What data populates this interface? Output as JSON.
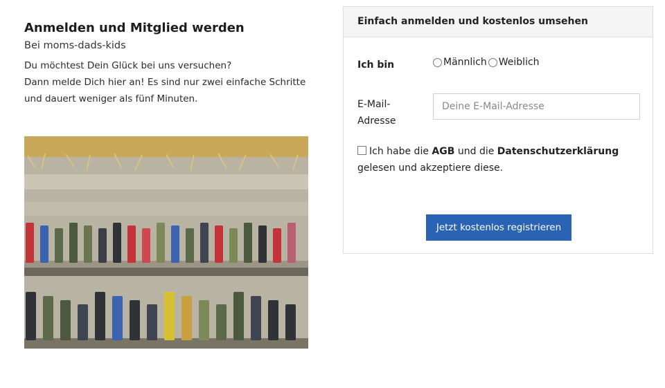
{
  "intro": {
    "title": "Anmelden und Mitglied werden",
    "subtitle": "Bei moms-dads-kids",
    "lines": [
      "Du möchtest Dein Glück bei uns versuchen?",
      "Dann melde Dich hier an! Es sind nur zwei einfache Schritte",
      "und dauert weniger als fünf Minuten."
    ]
  },
  "form": {
    "header": "Einfach anmelden und kostenlos umsehen",
    "gender_label": "Ich bin",
    "gender_options": [
      "Männlich",
      "Weiblich"
    ],
    "email_label_line1": "E-Mail-",
    "email_label_line2": "Adresse",
    "email_placeholder": "Deine E-Mail-Adresse",
    "email_value": "",
    "terms": {
      "prefix": "Ich habe die ",
      "agb": "AGB",
      "middle": " und die ",
      "privacy": "Datenschutzerklärung",
      "suffix": " gelesen und akzeptiere diese."
    },
    "submit_label": "Jetzt kostenlos registrieren"
  },
  "colors": {
    "button": "#2a63b3",
    "panel_header_bg": "#f5f5f5",
    "border": "#dcdcdc"
  }
}
